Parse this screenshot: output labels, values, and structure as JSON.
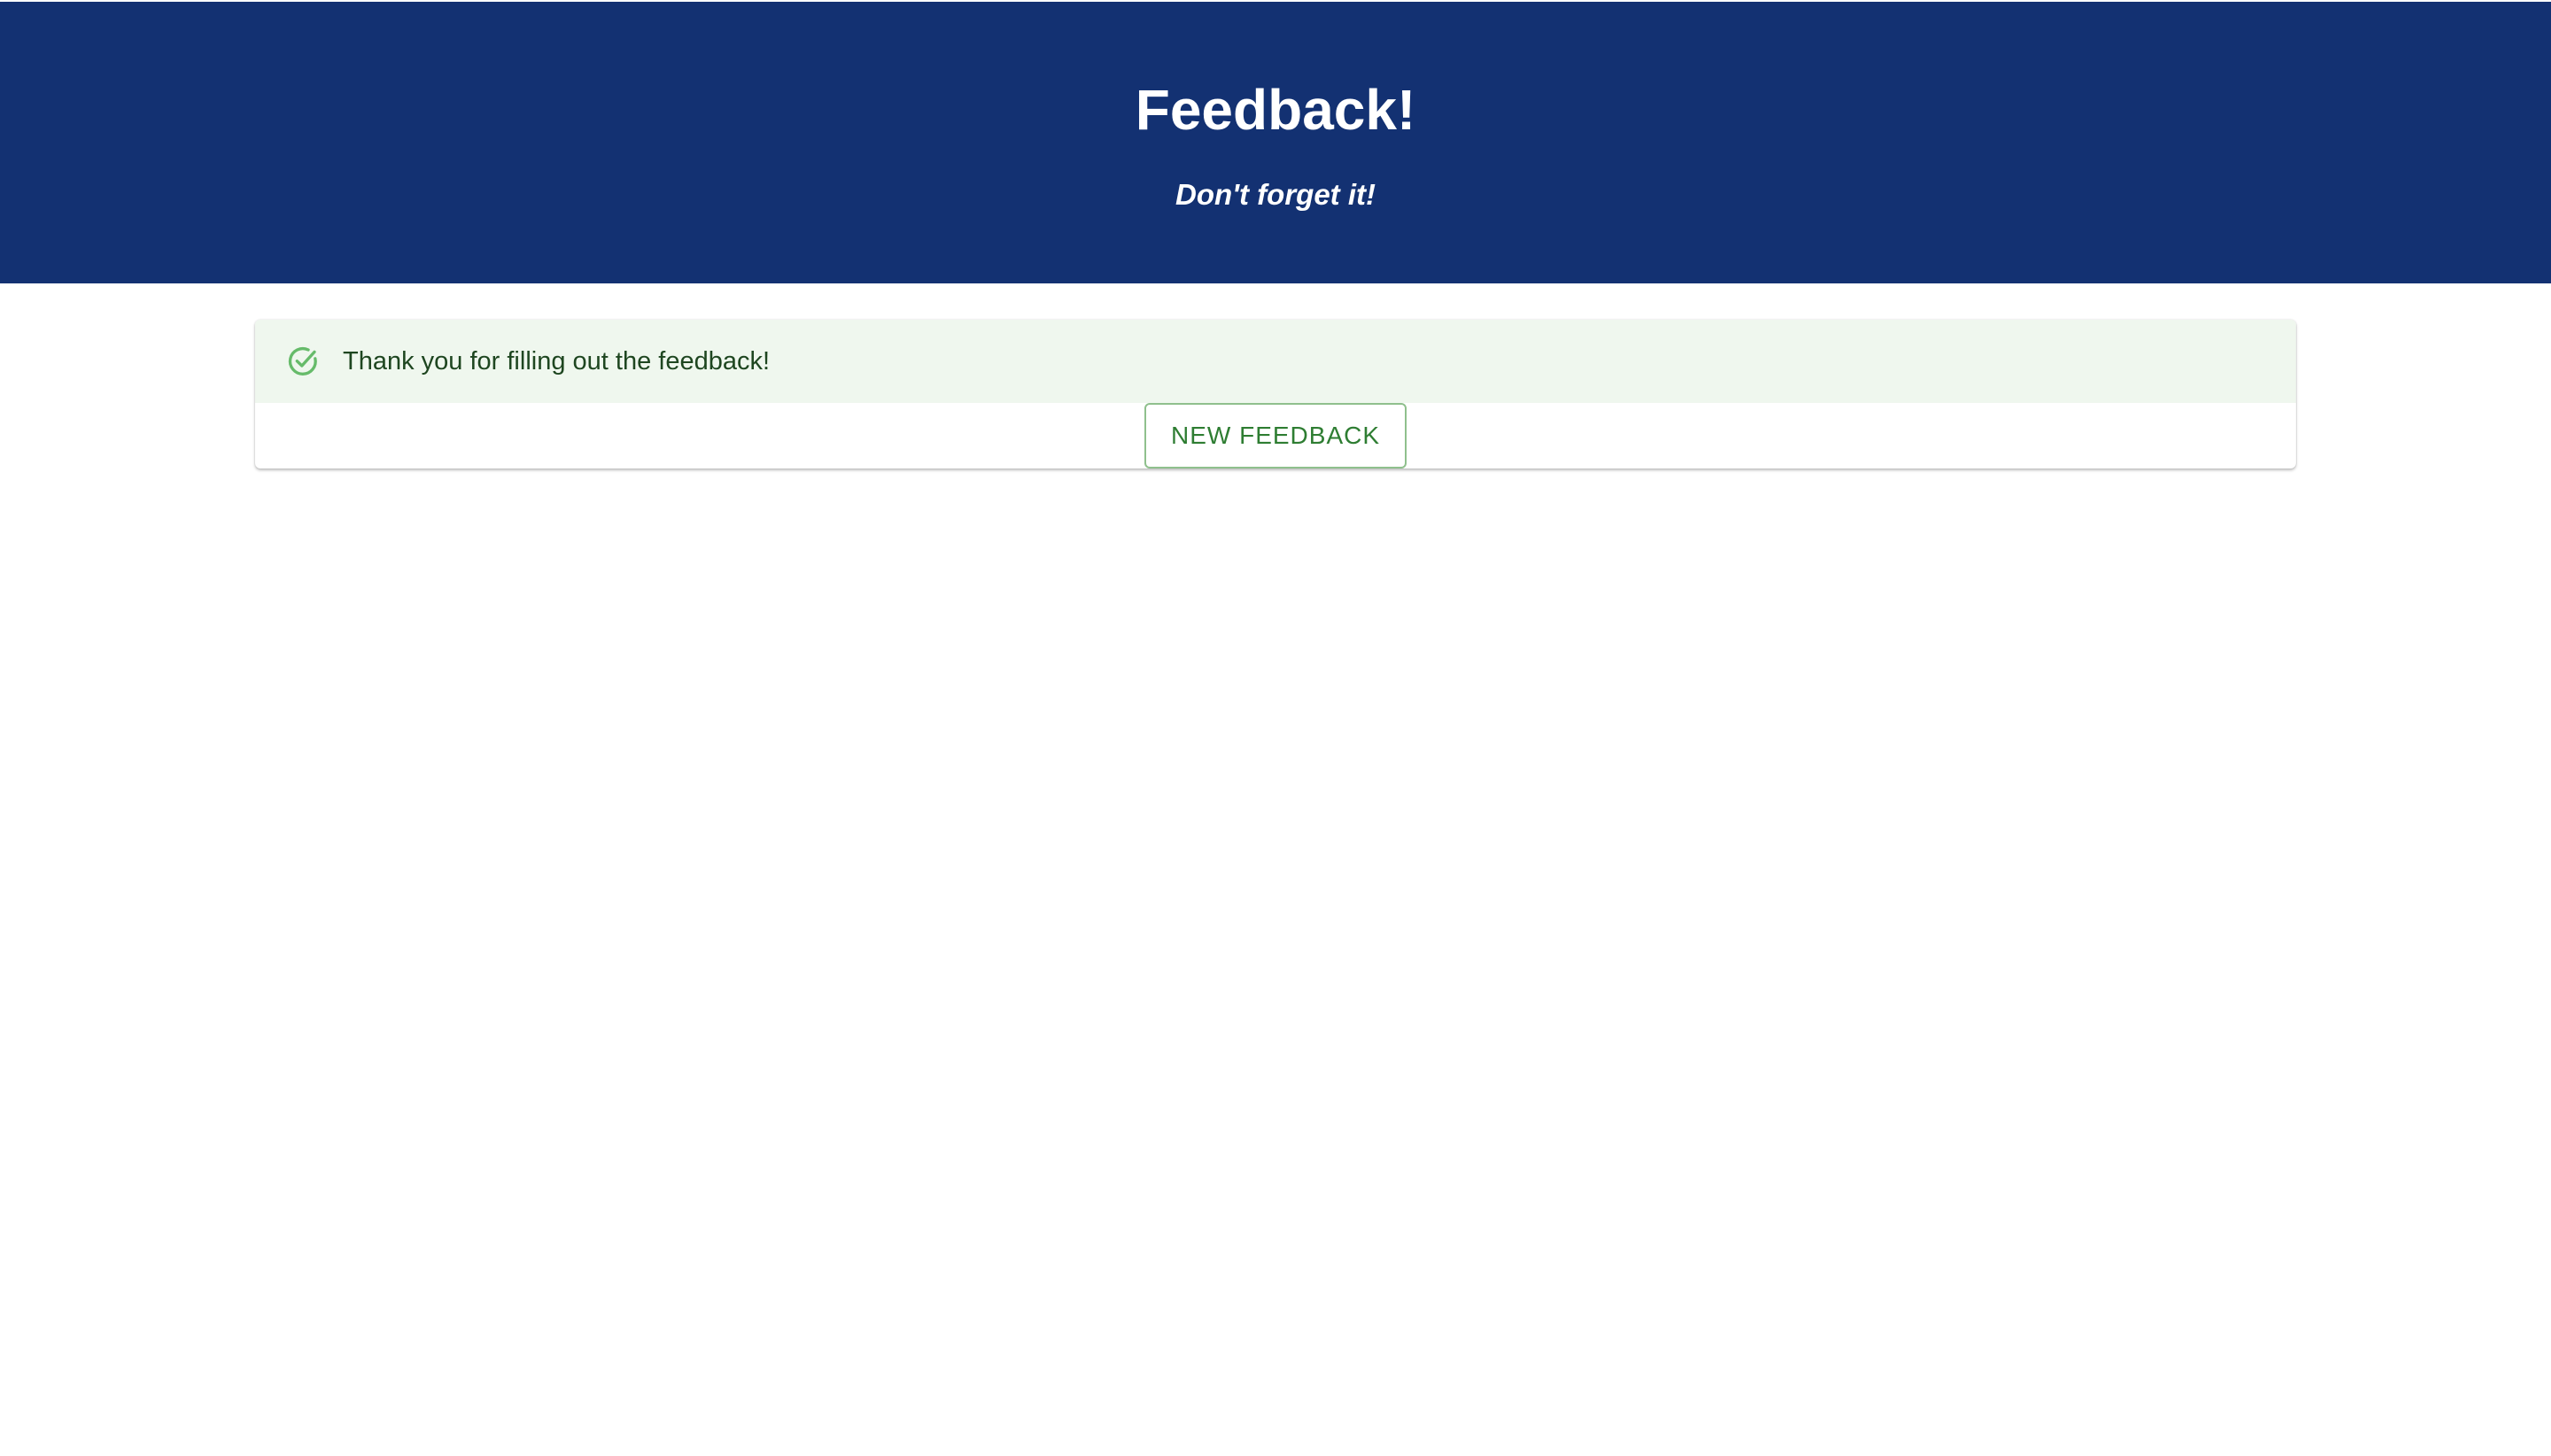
{
  "header": {
    "title": "Feedback!",
    "subtitle": "Don't forget it!",
    "background_color": "#133172"
  },
  "alert": {
    "icon": "check-circle-icon",
    "message": "Thank you for filling out the feedback!",
    "background_color": "#eff7ee",
    "accent_color": "#4caf50"
  },
  "actions": {
    "new_feedback_label": "NEW FEEDBACK"
  }
}
